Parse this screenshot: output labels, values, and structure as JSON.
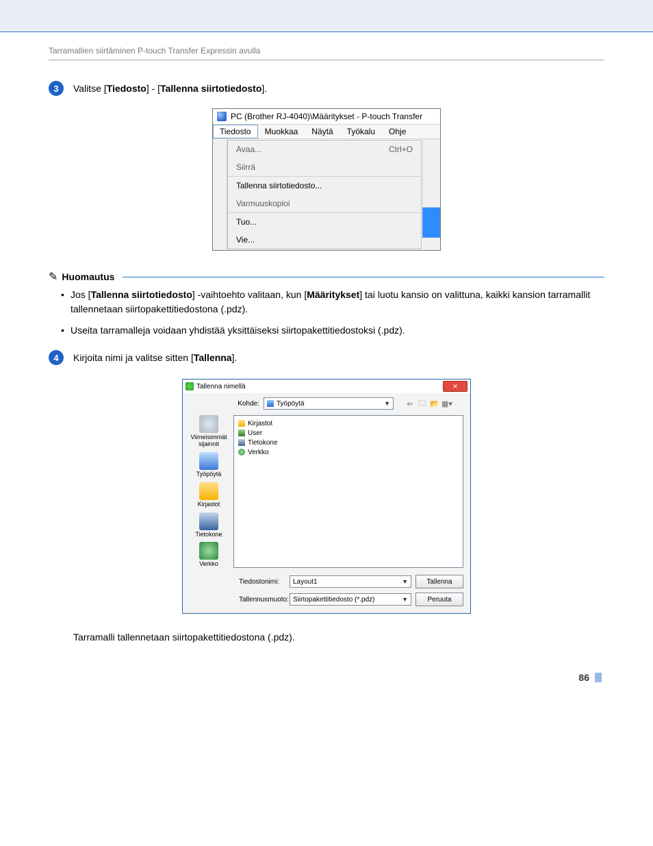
{
  "header": {
    "breadcrumb": "Tarramallien siirtäminen P-touch Transfer Expressin avulla"
  },
  "step3": {
    "number": "3",
    "prefix": "Valitse [",
    "menu1": "Tiedosto",
    "mid": "] - [",
    "menu2": "Tallenna siirtotiedosto",
    "suffix": "]."
  },
  "shot1": {
    "title": "PC (Brother RJ-4040)\\Määritykset - P-touch Transfer",
    "menubar": {
      "file": "Tiedosto",
      "edit": "Muokkaa",
      "view": "Näytä",
      "tools": "Työkalu",
      "help": "Ohje"
    },
    "items": {
      "open": "Avaa...",
      "open_sc": "Ctrl+O",
      "transfer": "Siirrä",
      "save_transfer": "Tallenna siirtotiedosto...",
      "backup": "Varmuuskopioi",
      "import": "Tuo...",
      "export": "Vie..."
    }
  },
  "note": {
    "label": "Huomautus",
    "b1a": "Jos [",
    "b1b": "Tallenna siirtotiedosto",
    "b1c": "] -vaihtoehto valitaan, kun [",
    "b1d": "Määritykset",
    "b1e": "] tai luotu kansio on valittuna, kaikki kansion tarramallit tallennetaan siirtopakettitiedostona (.pdz).",
    "b2": "Useita tarramalleja voidaan yhdistää yksittäiseksi siirtopakettitiedostoksi (.pdz)."
  },
  "step4": {
    "number": "4",
    "prefix": "Kirjoita nimi ja valitse sitten [",
    "button": "Tallenna",
    "suffix": "]."
  },
  "shot2": {
    "title": "Tallenna nimellä",
    "close": "✕",
    "kohde_label": "Kohde:",
    "kohde_value": "Työpöytä",
    "tb_icons": [
      "⇐",
      "🗀",
      "📂",
      "▦▾"
    ],
    "places": {
      "recent": "Viimeisimmät sijainnit",
      "desktop": "Työpöytä",
      "libraries": "Kirjastot",
      "computer": "Tietokone",
      "network": "Verkko"
    },
    "list": {
      "libraries": "Kirjastot",
      "user": "User",
      "computer": "Tietokone",
      "network": "Verkko"
    },
    "filename_label": "Tiedostonimi:",
    "filename_value": "Layout1",
    "filetype_label": "Tallennusmuoto:",
    "filetype_value": "Siirtopakettitiedosto (*.pdz)",
    "save_btn": "Tallenna",
    "cancel_btn": "Peruuta"
  },
  "after_para": "Tarramalli tallennetaan siirtopakettitiedostona (.pdz).",
  "page_number": "86"
}
